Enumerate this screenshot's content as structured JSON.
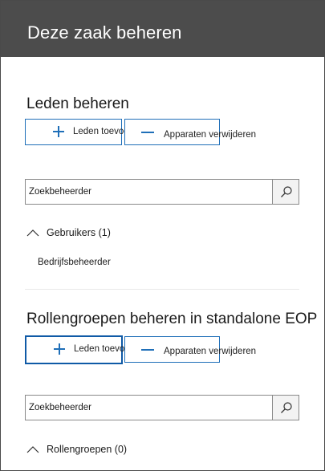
{
  "header": {
    "title": "Deze zaak beheren"
  },
  "members_section": {
    "title": "Leden beheren",
    "add_button_label": "Leden toevoegen",
    "remove_button_label": "Apparaten verwijderen",
    "search_placeholder": "Zoekbeheerder",
    "group": {
      "label": "Gebruikers (1)",
      "items": [
        "Bedrijfsbeheerder"
      ]
    }
  },
  "roles_section": {
    "title": "Rollengroepen beheren in standalone EOP",
    "add_button_label": "Leden toevoegen",
    "remove_button_label": "Apparaten verwijderen",
    "search_placeholder": "Zoekbeheerder",
    "group": {
      "label": "Rollengroepen (0)"
    }
  },
  "icons": {
    "add": "plus-icon",
    "remove": "minus-icon",
    "search": "search-icon",
    "collapse": "chevron-up-icon"
  },
  "colors": {
    "header_bg": "#4c4c4c",
    "accent": "#1f6fb8"
  }
}
